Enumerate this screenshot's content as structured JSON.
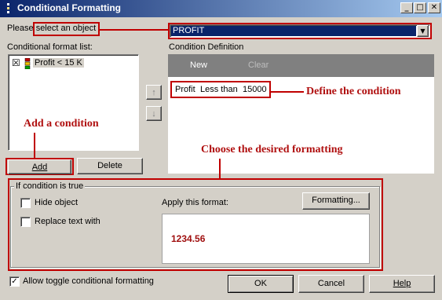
{
  "window": {
    "title": "Conditional Formatting"
  },
  "titlebar_buttons": {
    "minimize": "_",
    "maximize": "□",
    "close": "✕"
  },
  "object_select": {
    "label": "Please select an object",
    "value": "PROFIT",
    "arrow": "▼"
  },
  "format_list": {
    "label": "Conditional format list:",
    "items": [
      {
        "checked": "☒",
        "text": "Profit < 15 K"
      }
    ]
  },
  "condition_def": {
    "label": "Condition Definition",
    "new_label": "New",
    "clear_label": "Clear",
    "field": "Profit",
    "operator": "Less than",
    "value": "15000"
  },
  "move_buttons": {
    "up": "↑",
    "down": "↓"
  },
  "list_buttons": {
    "add": "Add",
    "delete": "Delete"
  },
  "if_true": {
    "group_label": "If condition is true",
    "hide_object": "Hide object",
    "replace_text": "Replace text with",
    "apply_label": "Apply this format:",
    "formatting_button": "Formatting...",
    "preview": "1234.56"
  },
  "footer": {
    "allow_toggle": "Allow toggle conditional formatting",
    "allow_toggle_checked": "✓",
    "ok": "OK",
    "cancel": "Cancel",
    "help": "Help"
  },
  "annotations": {
    "define": "Define the condition",
    "add": "Add a condition",
    "choose": "Choose the desired formatting"
  },
  "colors": {
    "annotation": "#c00000",
    "preview_text": "#a01010",
    "header_dark": "#808080"
  }
}
